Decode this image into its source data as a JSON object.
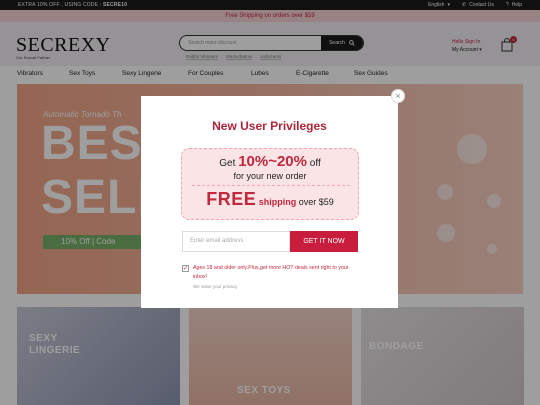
{
  "topbar": {
    "promo_prefix": "EXTRA 10% OFF , USING CODE : ",
    "promo_code": "SECRE10",
    "language": "English",
    "contact": "Contact Us",
    "help": "Help"
  },
  "shipping_bar": {
    "text": "Free Shipping on orders over $59"
  },
  "header": {
    "logo": "SECREXY",
    "tagline": "Our Sexual Partner",
    "search_placeholder": "Search more discount",
    "search_button": "Search",
    "suggestions": [
      "Rabbit Vibrators",
      "Masturbators",
      "Lubricants"
    ],
    "account_greeting": "Hello Sign In",
    "account_label": "My Account",
    "cart_count": "0"
  },
  "nav": {
    "items": [
      "Vibrators",
      "Sex Toys",
      "Sexy Lingerie",
      "For Couples",
      "Lubes",
      "E-Cigarette",
      "Sex Guides"
    ]
  },
  "banner": {
    "subtitle": "Automatic Tornado Th",
    "headline_1": "BES",
    "headline_2": "SELL",
    "code_text": "10% Off | Code"
  },
  "tiles": [
    {
      "label_1": "SEXY",
      "label_2": "LINGERIE"
    },
    {
      "label_1": "SEX TOYS"
    },
    {
      "label_1": "BONDAGE"
    }
  ],
  "modal": {
    "title": "New User Privileges",
    "offer_prefix": "Get ",
    "offer_percent": "10%~20%",
    "offer_suffix": " off",
    "offer_line2": "for your new order",
    "free_text": "FREE",
    "shipping_text": "shipping",
    "over_text": " over $59",
    "email_placeholder": "Enter email address",
    "submit_button": "GET IT NOW",
    "consent_text": "Ages 18 and older only.Plus,get more HOT deals sent right to your inbox!",
    "privacy_text": "We value your privacy.",
    "close_symbol": "×"
  },
  "colors": {
    "accent": "#c0283d",
    "button": "#c81d3c",
    "shipping_bar": "#f7d2d6",
    "banner": "#f3b39c"
  }
}
